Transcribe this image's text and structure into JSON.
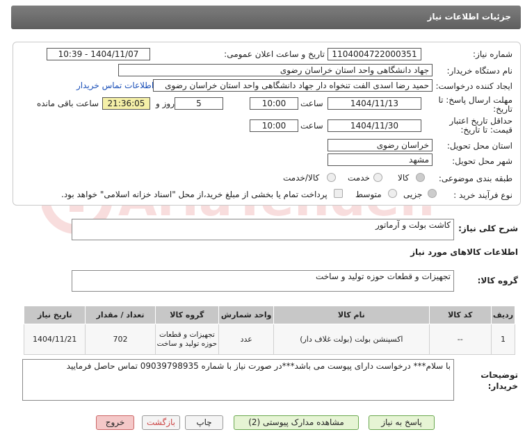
{
  "header": {
    "title": "جزئیات اطلاعات نیاز"
  },
  "form": {
    "need_number": {
      "label": "شماره نیاز:",
      "value": "1104004722000351"
    },
    "announce_datetime": {
      "label": "تاریخ و ساعت اعلان عمومی:",
      "value": "1404/11/07 - 10:39"
    },
    "buyer_org": {
      "label": "نام دستگاه خریدار:",
      "value": "جهاد دانشگاهی واحد استان خراسان رضوی"
    },
    "requester": {
      "label": "ایجاد کننده درخواست:",
      "value": "حمید رضا اسدی الفت تنخواه دار جهاد دانشگاهی واحد استان خراسان رضوی",
      "contact_link": "اطلاعات تماس خریدار"
    },
    "response_deadline": {
      "label": "مهلت ارسال پاسخ: تا تاریخ:",
      "date": "1404/11/13",
      "time_label": "ساعت",
      "time": "10:00",
      "days": "5",
      "days_label": "روز و",
      "remaining": "21:36:05",
      "remaining_label": "ساعت باقی مانده"
    },
    "price_validity": {
      "label": "حداقل تاریخ اعتبار قیمت: تا تاریخ:",
      "date": "1404/11/30",
      "time_label": "ساعت",
      "time": "10:00"
    },
    "delivery_province": {
      "label": "استان محل تحویل:",
      "value": "خراسان رضوی"
    },
    "delivery_city": {
      "label": "شهر محل تحویل:",
      "value": "مشهد"
    },
    "category": {
      "label": "طبقه بندی موضوعی:",
      "options": [
        "کالا",
        "خدمت",
        "کالا/خدمت"
      ],
      "selected": "کالا"
    },
    "process_type": {
      "label": "نوع فرآیند خرید :",
      "options": [
        "جزیی",
        "متوسط"
      ],
      "selected": "جزیی",
      "payment_note": "پرداخت تمام یا بخشی از مبلغ خرید،از محل \"اسناد خزانه اسلامی\" خواهد بود."
    }
  },
  "summary": {
    "label": "شرح کلی نیاز:",
    "value": "کاشت بولت و آرماتور"
  },
  "goods_info": {
    "title": "اطلاعات کالاهای مورد نیاز",
    "group_label": "گروه کالا:",
    "group_value": "تجهیزات و قطعات حوزه تولید و ساخت"
  },
  "table": {
    "headers": [
      "ردیف",
      "کد کالا",
      "نام کالا",
      "واحد شمارش",
      "گروه کالا",
      "تعداد / مقدار",
      "تاریخ نیاز"
    ],
    "rows": [
      [
        "1",
        "--",
        "اکسپنشن بولت (بولت غلاف دار)",
        "عدد",
        "تجهیزات و قطعات حوزه تولید و ساخت",
        "702",
        "1404/11/21"
      ]
    ]
  },
  "buyer_notes": {
    "label": "توضیحات خریدار:",
    "value": "با سلام*** درخواست دارای پیوست می باشد***در صورت نیاز با شماره 09039798935 تماس حاصل فرمایید"
  },
  "buttons": {
    "reply": "پاسخ به نیاز",
    "attachments": "مشاهده مدارک پیوستی (2)",
    "print": "چاپ",
    "back": "بازگشت",
    "exit": "خروج"
  },
  "watermark": "AriaTender.net",
  "colors": {
    "header_bg": "#6e6e6e",
    "link": "#1a4fb8",
    "remaining_bg": "#f5f0a8",
    "reply_btn": "#e6f4d4",
    "exit_btn": "#f4c8c8"
  }
}
